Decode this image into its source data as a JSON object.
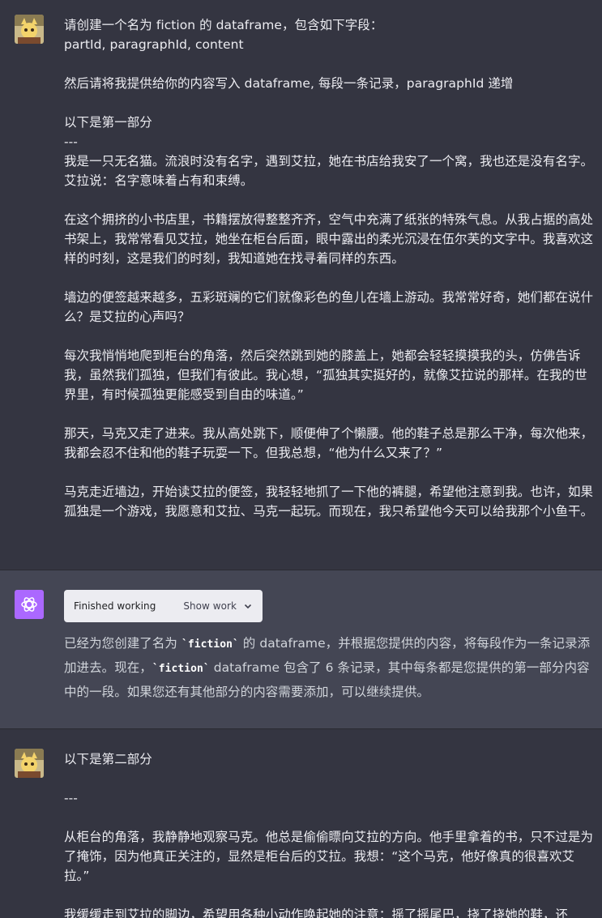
{
  "messages": [
    {
      "role": "user",
      "lines_a": "请创建一个名为 fiction 的 dataframe，包含如下字段：",
      "lines_b": "partId, paragraphId, content",
      "paragraphs": [
        "然后请将我提供给你的内容写入 dataframe, 每段一条记录，paragraphId 递增",
        "以下是第一部分\n---\n我是一只无名猫。流浪时没有名字，遇到艾拉，她在书店给我安了一个窝，我也还是没有名字。艾拉说：名字意味着占有和束缚。",
        "在这个拥挤的小书店里，书籍摆放得整整齐齐，空气中充满了纸张的特殊气息。从我占据的高处书架上，我常常看见艾拉，她坐在柜台后面，眼中露出的柔光沉浸在伍尔芙的文字中。我喜欢这样的时刻，这是我们的时刻，我知道她在找寻着同样的东西。",
        "墙边的便签越来越多，五彩斑斓的它们就像彩色的鱼儿在墙上游动。我常常好奇，她们都在说什么？是艾拉的心声吗？",
        "每次我悄悄地爬到柜台的角落，然后突然跳到她的膝盖上，她都会轻轻摸摸我的头，仿佛告诉我，虽然我们孤独，但我们有彼此。我心想，“孤独其实挺好的，就像艾拉说的那样。在我的世界里，有时候孤独更能感受到自由的味道。”",
        "那天，马克又走了进来。我从高处跳下，顺便伸了个懒腰。他的鞋子总是那么干净，每次他来，我都会忍不住和他的鞋子玩耍一下。但我总想，“他为什么又来了？”",
        "马克走近墙边，开始读艾拉的便签，我轻轻地抓了一下他的裤腿，希望他注意到我。也许，如果孤独是一个游戏，我愿意和艾拉、马克一起玩。而现在，我只希望他今天可以给我那个小鱼干。"
      ]
    },
    {
      "role": "assistant",
      "work_status": "Finished working",
      "work_toggle": "Show work",
      "reply_1": "已经为您创建了名为 ",
      "reply_code_1": "`fiction`",
      "reply_2": " 的 dataframe，并根据您提供的内容，将每段作为一条记录添加进去。现在，",
      "reply_code_2": "`fiction`",
      "reply_3": " dataframe 包含了 6 条记录，其中每条都是您提供的第一部分内容中的一段。如果您还有其他部分的内容需要添加，可以继续提供。"
    },
    {
      "role": "user",
      "paragraphs": [
        "以下是第二部分",
        "---",
        "从柜台的角落，我静静地观察马克。他总是偷偷瞟向艾拉的方向。他手里拿着的书，只不过是为了掩饰，因为他真正关注的，显然是柜台后的艾拉。我想：“这个马克，他好像真的很喜欢艾拉。”",
        "我缓缓走到艾拉的脚边，希望用各种小动作唤起她的注意：摇了摇尾巴，挠了挠她的鞋，还"
      ]
    }
  ],
  "colors": {
    "user_bg": "#343541",
    "assistant_bg": "#444654",
    "gpt_avatar": "#ab68ff",
    "pill_bg": "#ececf1"
  },
  "icons": [
    "user-avatar-icon",
    "openai-logo-icon",
    "chevron-down-icon"
  ]
}
